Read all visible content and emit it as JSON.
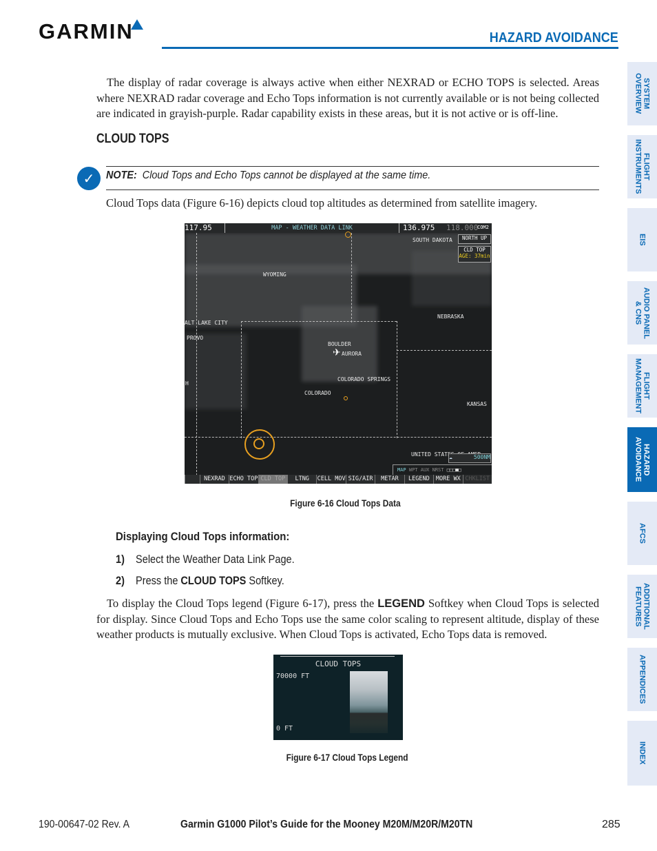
{
  "header": {
    "logo": "GARMIN",
    "section": "HAZARD AVOIDANCE"
  },
  "intro": "The display of radar coverage is always active when either NEXRAD or ECHO TOPS is selected.  Areas where NEXRAD radar coverage and Echo Tops information is not currently available or is not being collected are indicated in grayish-purple. Radar capability exists in these areas, but it is not active or is off-line.",
  "heading": "CLOUD TOPS",
  "note": {
    "label": "NOTE:",
    "text": "Cloud Tops and Echo Tops cannot be displayed at the same time."
  },
  "para1": "Cloud Tops data (Figure 6-16) depicts cloud top altitudes as determined from satellite imagery.",
  "figure1": {
    "caption": "Figure 6-16  Cloud Tops Data",
    "com1": "117.95",
    "title": "MAP - WEATHER DATA LINK",
    "com2_active": "136.975",
    "com2_standby": "118.000",
    "com2_label": "COM2",
    "orientation": "NORTH UP",
    "product": "CLD TOP",
    "age": "AGE: 37min",
    "labels": [
      "SOUTH DAKOTA",
      "WYOMING",
      "NEBRASKA",
      "ALT LAKE CITY",
      "PROVO",
      "BOULDER",
      "AURORA",
      "COLORADO SPRINGS",
      "COLORADO",
      "KANSAS",
      "H",
      "UNITED STATES OF AMER"
    ],
    "range": "500NM",
    "pages": [
      "MAP",
      "WPT",
      "AUX",
      "NRST"
    ],
    "softkeys": [
      "NEXRAD",
      "ECHO TOP",
      "CLD TOP",
      "LTNG",
      "CELL MOV",
      "SIG/AIR",
      "METAR",
      "LEGEND",
      "MORE WX",
      "CHKLIST"
    ],
    "colors": {
      "amber": "#e8a020",
      "cyan": "#7fd0d8"
    }
  },
  "subheading": "Displaying Cloud Tops information:",
  "steps": [
    {
      "num": "1)",
      "text": "Select the Weather Data Link Page."
    },
    {
      "num": "2)",
      "pre": "Press the ",
      "bold": "CLOUD TOPS",
      "post": " Softkey."
    }
  ],
  "para2": {
    "pre": "To display the Cloud Tops legend (Figure 6-17), press the ",
    "bold": "LEGEND",
    "post": " Softkey when Cloud Tops is selected for display.   Since Cloud Tops and Echo Tops use the same color scaling to represent altitude, display of these weather products is mutually exclusive.  When Cloud Tops is activated, Echo Tops data is removed."
  },
  "figure2": {
    "caption": "Figure 6-17  Cloud Tops Legend",
    "title": "CLOUD TOPS",
    "max": "70000 FT",
    "min": "0 FT"
  },
  "tabs": [
    "SYSTEM\nOVERVIEW",
    "FLIGHT\nINSTRUMENTS",
    "EIS",
    "AUDIO PANEL\n& CNS",
    "FLIGHT\nMANAGEMENT",
    "HAZARD\nAVOIDANCE",
    "AFCS",
    "ADDITIONAL\nFEATURES",
    "APPENDICES",
    "INDEX"
  ],
  "footer": {
    "doc": "190-00647-02  Rev. A",
    "title": "Garmin G1000 Pilot’s Guide for the Mooney M20M/M20R/M20TN",
    "page": "285"
  }
}
